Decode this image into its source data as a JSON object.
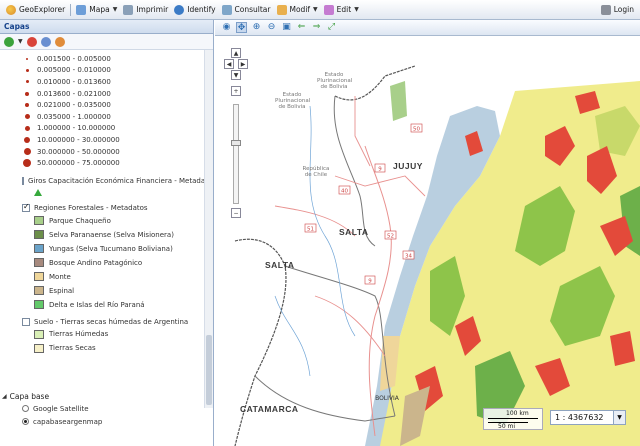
{
  "toolbar": {
    "app_name": "GeoExplorer",
    "items": [
      {
        "label": "Mapa",
        "has_menu": true
      },
      {
        "label": "Imprimir",
        "has_menu": false
      },
      {
        "label": "Identify",
        "has_menu": false
      },
      {
        "label": "Consultar",
        "has_menu": false
      },
      {
        "label": "Modif",
        "has_menu": true
      },
      {
        "label": "Edit",
        "has_menu": true
      }
    ],
    "login_label": "Login"
  },
  "layers_panel": {
    "title": "Capas",
    "range_legend": [
      "0.001500 - 0.005000",
      "0.005000 - 0.010000",
      "0.010000 - 0.013600",
      "0.013600 - 0.021000",
      "0.021000 - 0.035000",
      "0.035000 - 1.000000",
      "1.000000 - 10.000000",
      "10.000000 - 30.000000",
      "30.000000 - 50.000000",
      "50.000000 - 75.000000"
    ],
    "layers": [
      {
        "label": "Giros Capacitación Económica Financiera - Metadatos",
        "checked": false
      },
      {
        "label": "Regiones Forestales - Metadatos",
        "checked": true,
        "legend": [
          {
            "label": "Parque Chaqueño",
            "color": "#a8cf8a"
          },
          {
            "label": "Selva Paranaense (Selva Misionera)",
            "color": "#6c8f4a"
          },
          {
            "label": "Yungas (Selva Tucumano Boliviana)",
            "color": "#6aa3c9"
          },
          {
            "label": "Bosque Andino Patagónico",
            "color": "#a78a7e"
          },
          {
            "label": "Monte",
            "color": "#efd69a"
          },
          {
            "label": "Espinal",
            "color": "#cbb58c"
          },
          {
            "label": "Delta e Islas del Río Paraná",
            "color": "#63c96a"
          }
        ]
      },
      {
        "label": "Suelo - Tierras secas húmedas de Argentina",
        "checked": false,
        "legend": [
          {
            "label": "Tierras Húmedas",
            "color": "#d9efb6"
          },
          {
            "label": "Tierras Secas",
            "color": "#f6f0c8"
          }
        ]
      }
    ],
    "base_layers": {
      "title": "Capa base",
      "options": [
        {
          "label": "Google Satellite",
          "selected": false
        },
        {
          "label": "capabaseargenmap",
          "selected": true
        }
      ]
    }
  },
  "map": {
    "labels": {
      "jujuy": "JUJUY",
      "salta_prov": "SALTA",
      "salta_city": "SALTA",
      "catamarca": "CATAMARCA",
      "bolivia1": "Estado Plurinacional de Bolivia",
      "bolivia2": "Estado Plurinacional de Bolivia",
      "chile": "República de Chile",
      "boliv_bot": "BOLIVIA"
    },
    "route_numbers": [
      "9",
      "40",
      "51",
      "52",
      "9",
      "34",
      "50"
    ],
    "scale": {
      "top": "100 km",
      "bottom": "50 mi"
    },
    "ratio": "1 : 4367632",
    "colors": {
      "yungas": "#b9cfe0",
      "chaco": "#f0ec8c",
      "chaco_dark": "#8ec44a",
      "forest": "#6db04a",
      "red": "#e34a3a",
      "border": "#555555",
      "road": "#e8918f"
    }
  }
}
